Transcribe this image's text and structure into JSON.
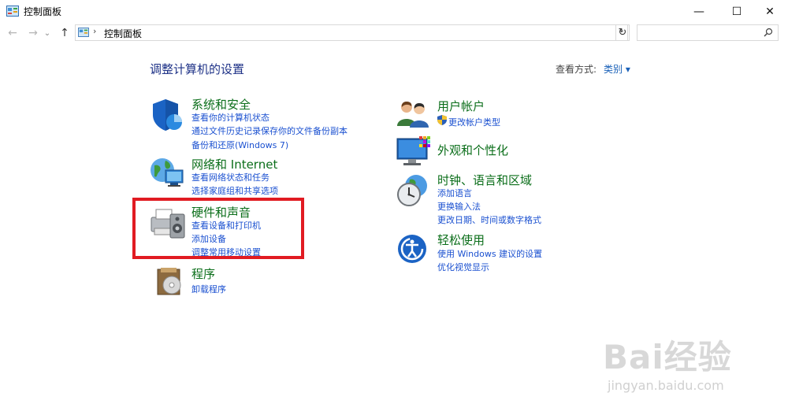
{
  "window": {
    "title": "控制面板",
    "minimize_glyph": "—",
    "maximize_glyph": "☐",
    "close_glyph": "✕"
  },
  "nav": {
    "back_glyph": "←",
    "forward_glyph": "→",
    "recent_glyph": "⌄",
    "up_glyph": "↑",
    "address_sep": "›",
    "address": "控制面板",
    "address_dd": "⌄",
    "refresh_glyph": "↻",
    "search_placeholder": ""
  },
  "header": {
    "title": "调整计算机的设置",
    "view_by_label": "查看方式:",
    "view_by_value": "类别 ▾"
  },
  "categories": {
    "system": {
      "title": "系统和安全",
      "icon": "shield-icon",
      "links": [
        "查看你的计算机状态",
        "通过文件历史记录保存你的文件备份副本",
        "备份和还原(Windows 7)"
      ]
    },
    "network": {
      "title": "网络和 Internet",
      "icon": "network-globe-icon",
      "links": [
        "查看网络状态和任务",
        "选择家庭组和共享选项"
      ]
    },
    "hardware": {
      "title": "硬件和声音",
      "icon": "printer-speaker-icon",
      "links": [
        "查看设备和打印机",
        "添加设备",
        "调整常用移动设置"
      ]
    },
    "programs": {
      "title": "程序",
      "icon": "program-disc-icon",
      "links": [
        "卸载程序"
      ]
    },
    "users": {
      "title": "用户帐户",
      "icon": "users-icon",
      "links": [
        "更改帐户类型"
      ]
    },
    "appearance": {
      "title": "外观和个性化",
      "icon": "monitor-palette-icon",
      "links": []
    },
    "clock": {
      "title": "时钟、语言和区域",
      "icon": "clock-globe-icon",
      "links": [
        "添加语言",
        "更换输入法",
        "更改日期、时间或数字格式"
      ]
    },
    "ease": {
      "title": "轻松使用",
      "icon": "ease-of-access-icon",
      "links": [
        "使用 Windows 建议的设置",
        "优化视觉显示"
      ]
    }
  },
  "watermark": {
    "brand": "Bai经验",
    "url": "jingyan.baidu.com"
  },
  "colors": {
    "heading": "#1e3287",
    "category_title": "#0b6e1a",
    "link": "#1a50d0",
    "highlight": "#e11b22"
  }
}
